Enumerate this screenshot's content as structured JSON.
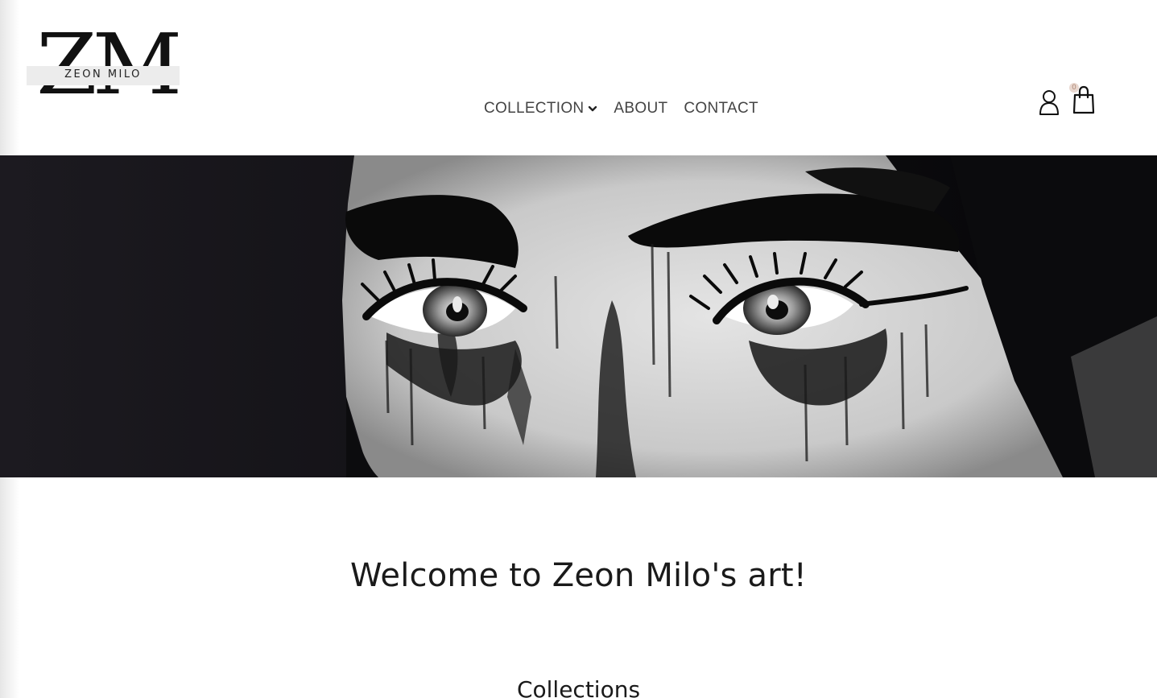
{
  "brand": {
    "logo_letters": "ZM",
    "logo_text": "ZEON MILO"
  },
  "nav": {
    "items": [
      {
        "label": "COLLECTION",
        "has_dropdown": true
      },
      {
        "label": "ABOUT"
      },
      {
        "label": "CONTACT"
      }
    ]
  },
  "header_icons": {
    "account": "user-icon",
    "cart": "shopping-bag-icon",
    "cart_count": "0"
  },
  "hero": {
    "image": "black-and-white-painted-eyes-artwork"
  },
  "main": {
    "welcome_heading": "Welcome to Zeon Milo's art!",
    "collections_heading": "Collections"
  },
  "colors": {
    "text": "#1a1a1a",
    "nav_text": "#444444",
    "hero_bg": "#0a090c",
    "badge_bg": "#e9d8d0"
  }
}
